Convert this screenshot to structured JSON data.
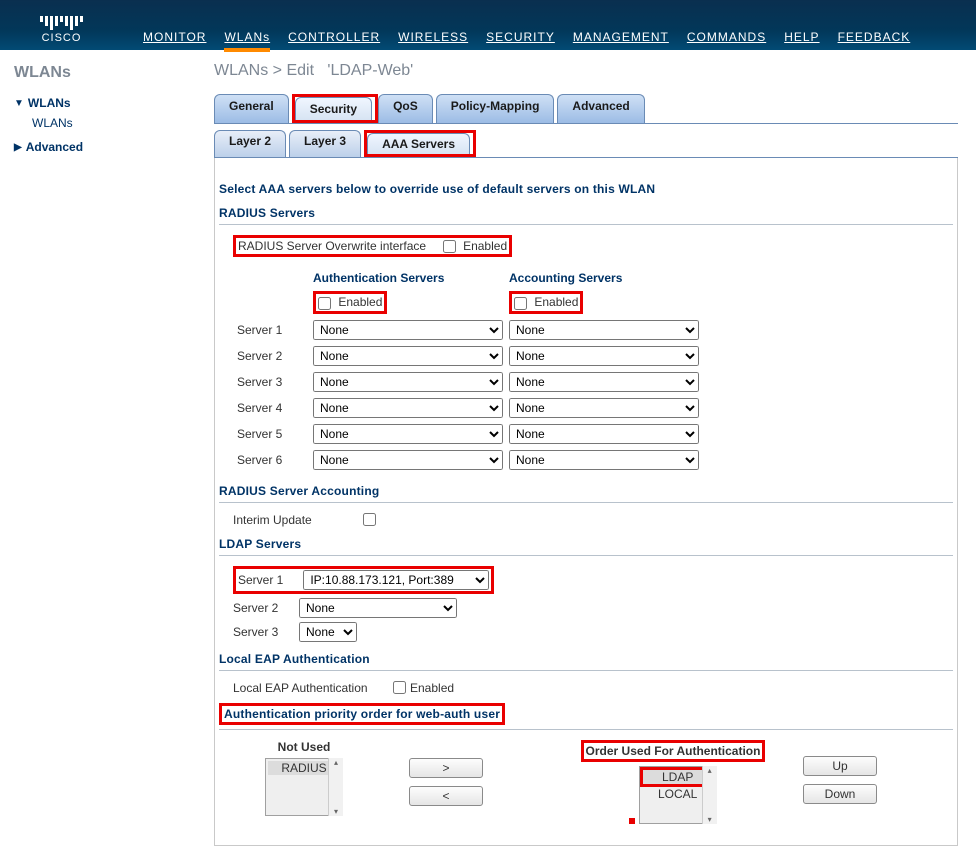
{
  "brand": "CISCO",
  "nav": {
    "monitor": "MONITOR",
    "wlans": "WLANs",
    "controller": "CONTROLLER",
    "wireless": "WIRELESS",
    "security": "SECURITY",
    "management": "MANAGEMENT",
    "commands": "COMMANDS",
    "help": "HELP",
    "feedback": "FEEDBACK"
  },
  "sidebar": {
    "title": "WLANs",
    "wlans": "WLANs",
    "wlans_sub": "WLANs",
    "advanced": "Advanced"
  },
  "crumb": {
    "a": "WLANs",
    "b": "Edit",
    "name": "'LDAP-Web'"
  },
  "tabs": {
    "general": "General",
    "security": "Security",
    "qos": "QoS",
    "policy": "Policy-Mapping",
    "advanced": "Advanced"
  },
  "subtabs": {
    "l2": "Layer 2",
    "l3": "Layer 3",
    "aaa": "AAA Servers"
  },
  "text": {
    "select_aaa": "Select AAA servers below to override use of default servers on this WLAN",
    "radius_servers": "RADIUS Servers",
    "overwrite": "RADIUS Server Overwrite interface",
    "enabled": "Enabled",
    "auth_servers": "Authentication Servers",
    "acct_servers": "Accounting Servers",
    "server1": "Server 1",
    "server2": "Server 2",
    "server3": "Server 3",
    "server4": "Server 4",
    "server5": "Server 5",
    "server6": "Server 6",
    "radius_acct": "RADIUS Server Accounting",
    "interim": "Interim Update",
    "ldap_servers": "LDAP Servers",
    "local_eap_h": "Local EAP Authentication",
    "local_eap": "Local EAP Authentication",
    "auth_priority": "Authentication priority order for web-auth user",
    "not_used": "Not Used",
    "order_used": "Order Used For Authentication",
    "gt": ">",
    "lt": "<",
    "up": "Up",
    "down": "Down"
  },
  "values": {
    "auth_s1": "None",
    "auth_s2": "None",
    "auth_s3": "None",
    "auth_s4": "None",
    "auth_s5": "None",
    "auth_s6": "None",
    "acct_s1": "None",
    "acct_s2": "None",
    "acct_s3": "None",
    "acct_s4": "None",
    "acct_s5": "None",
    "acct_s6": "None",
    "ldap_s1": "IP:10.88.173.121, Port:389",
    "ldap_s2": "None",
    "ldap_s3": "None",
    "not_used_item": "RADIUS",
    "used_item1": "LDAP",
    "used_item2": "LOCAL"
  }
}
